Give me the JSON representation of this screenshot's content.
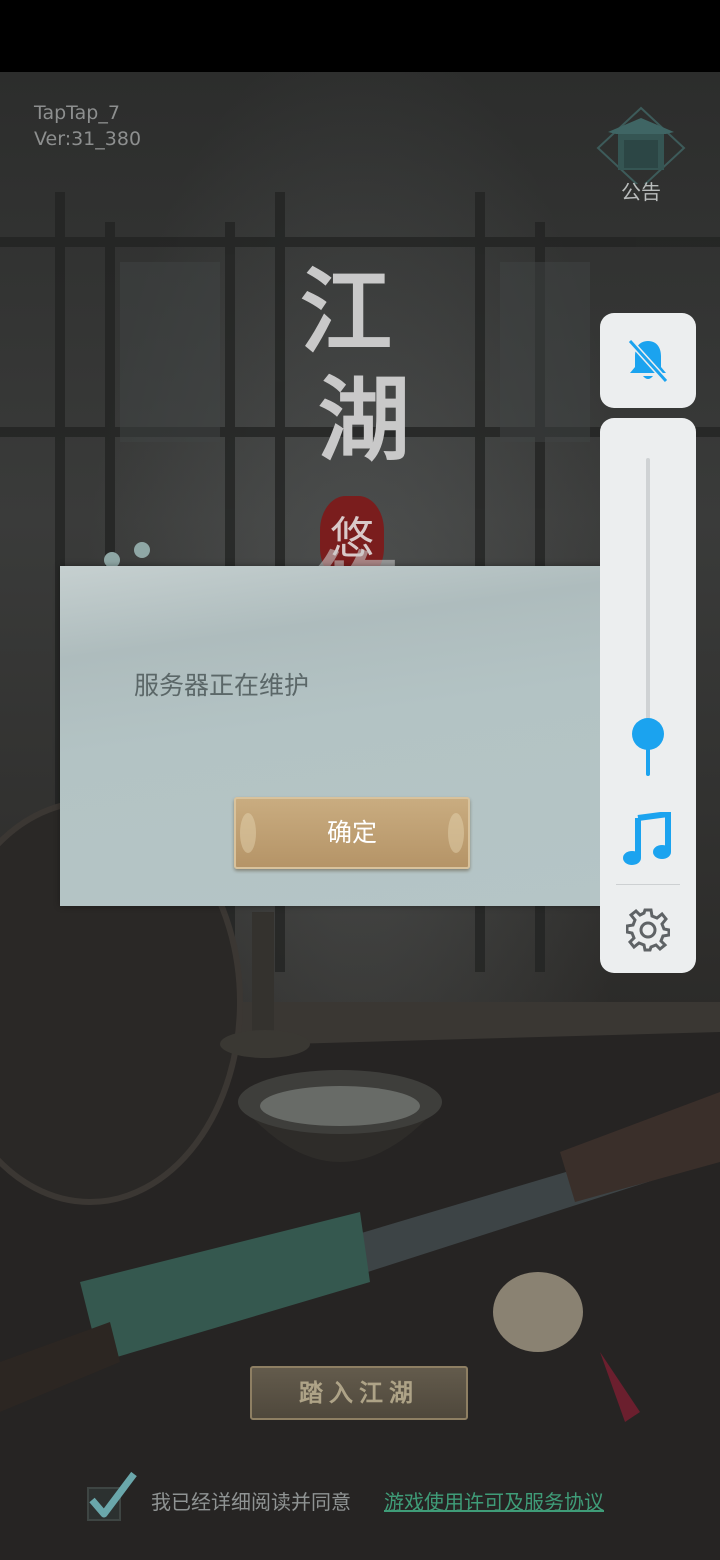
{
  "app": {
    "version_line1": "TapTap_7",
    "version_line2": "Ver:31_380",
    "notice_label": "公告"
  },
  "title": {
    "chars": [
      "江",
      "湖",
      "悠",
      "悠"
    ],
    "seal_char": "悠"
  },
  "dialog": {
    "message": "服务器正在维护",
    "confirm_label": "确定"
  },
  "side_panel": {
    "mute_icon": "bell-off-icon",
    "volume_level": 0.14,
    "music_icon": "music-note-icon",
    "settings_icon": "gear-icon",
    "accent_color": "#1ba3ef"
  },
  "enter_button": {
    "label": "踏入江湖"
  },
  "agreement": {
    "checked": true,
    "text": "我已经详细阅读并同意",
    "link": "游戏使用许可及服务协议"
  },
  "colors": {
    "dialog_bg": "#b5c5c6",
    "confirm_button": "#c3a678",
    "link": "#3f9c78"
  }
}
